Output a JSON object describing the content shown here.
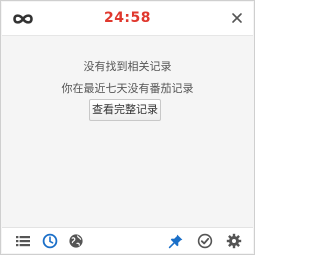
{
  "header": {
    "timer": "24:58",
    "timer_color": "#e0382e",
    "logo_icon": "infinity-icon",
    "close_icon": "close-icon"
  },
  "main": {
    "empty_title": "没有找到相关记录",
    "empty_subtitle": "你在最近七天没有番茄记录",
    "view_all_button": "查看完整记录"
  },
  "footer": {
    "left_icons": [
      "list-icon",
      "clock-icon",
      "globe-icon"
    ],
    "right_icons": [
      "pin-icon",
      "check-circle-icon",
      "gear-icon"
    ],
    "accent_color": "#1b6fc8",
    "icon_color": "#555555"
  }
}
